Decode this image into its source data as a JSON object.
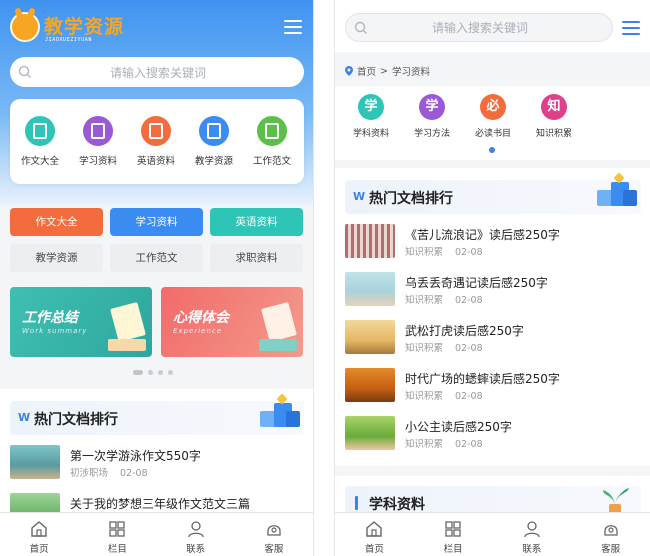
{
  "left": {
    "logo": {
      "title": "教学资源",
      "subtitle": "JIAOXUEZIYUAN"
    },
    "search": {
      "placeholder": "请输入搜索关键词"
    },
    "categories": [
      {
        "label": "作文大全",
        "color": "#2ec5b6"
      },
      {
        "label": "学习资料",
        "color": "#9b59d6"
      },
      {
        "label": "英语资料",
        "color": "#f36c3e"
      },
      {
        "label": "教学资源",
        "color": "#3b8cf0"
      },
      {
        "label": "工作范文",
        "color": "#5cbf4a"
      }
    ],
    "quick_links": [
      {
        "label": "作文大全",
        "color": "#f36c3e"
      },
      {
        "label": "学习资料",
        "color": "#3b8cf0"
      },
      {
        "label": "英语资料",
        "color": "#2ec5b6"
      },
      {
        "label": "教学资源"
      },
      {
        "label": "工作范文"
      },
      {
        "label": "求职资料"
      }
    ],
    "banners": [
      {
        "title": "工作总结",
        "subtitle": "Work summary"
      },
      {
        "title": "心得体会",
        "subtitle": "Experience"
      }
    ],
    "carousel": {
      "count": 4,
      "active": 1
    },
    "ranking": {
      "title": "热门文档排行",
      "items": [
        {
          "title": "第一次学游泳作文550字",
          "tag": "初涉职场",
          "date": "02-08"
        },
        {
          "title": "关于我的梦想三年级作文范文三篇",
          "tag": "",
          "date": ""
        }
      ]
    }
  },
  "right": {
    "search": {
      "placeholder": "请输入搜索关键词"
    },
    "breadcrumb": {
      "home": "首页",
      "sep": ">",
      "current": "学习资料"
    },
    "categories": [
      {
        "glyph": "学",
        "label": "学科资料",
        "color": "#2ec5b6"
      },
      {
        "glyph": "学",
        "label": "学习方法",
        "color": "#9b59d6"
      },
      {
        "glyph": "必",
        "label": "必读书目",
        "color": "#f36c3e"
      },
      {
        "glyph": "知",
        "label": "知识积累",
        "color": "#e0408a"
      }
    ],
    "ranking": {
      "title": "热门文档排行",
      "items": [
        {
          "title": "《苦儿流浪记》读后感250字",
          "tag": "知识积累",
          "date": "02-08"
        },
        {
          "title": "乌丢丢奇遇记读后感250字",
          "tag": "知识积累",
          "date": "02-08"
        },
        {
          "title": "武松打虎读后感250字",
          "tag": "知识积累",
          "date": "02-08"
        },
        {
          "title": "时代广场的蟋蟀读后感250字",
          "tag": "知识积累",
          "date": "02-08"
        },
        {
          "title": "小公主读后感250字",
          "tag": "知识积累",
          "date": "02-08"
        }
      ]
    },
    "learning": {
      "title": "学科资料"
    }
  },
  "tabbar": [
    {
      "label": "首页",
      "icon": "home-icon"
    },
    {
      "label": "栏目",
      "icon": "grid-icon"
    },
    {
      "label": "联系",
      "icon": "user-icon"
    },
    {
      "label": "客服",
      "icon": "headset-icon"
    }
  ],
  "colors": {
    "accent": "#3b82e6",
    "hero_top": "#3f93f0",
    "logo": "#f5a623"
  }
}
